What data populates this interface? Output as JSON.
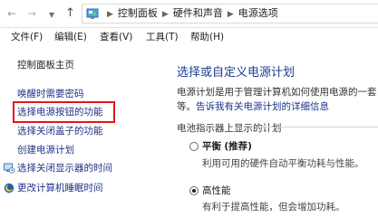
{
  "address": {
    "crumbs": [
      "控制面板",
      "硬件和声音",
      "电源选项"
    ]
  },
  "menu": [
    {
      "label": "文件(F)"
    },
    {
      "label": "编辑(E)"
    },
    {
      "label": "查看(V)"
    },
    {
      "label": "工具(T)"
    },
    {
      "label": "帮助(H)"
    }
  ],
  "sidebar": {
    "items": [
      {
        "label": "控制面板主页"
      },
      {
        "label": "唤醒时需要密码"
      },
      {
        "label": "选择电源按钮的功能"
      },
      {
        "label": "选择关闭盖子的功能"
      },
      {
        "label": "创建电源计划"
      },
      {
        "label": "选择关闭显示器的时间"
      },
      {
        "label": "更改计算机睡眠时间"
      }
    ]
  },
  "main": {
    "title": "选择或自定义电源计划",
    "desc_line1": "电源计划是用于管理计算机如何使用电源的一套",
    "desc_line2_prefix": "等。",
    "desc_line2_link": "告诉我有关电源计划的详细信息",
    "plans_header": "电池指示器上显示的计划",
    "plans": [
      {
        "name": "平衡",
        "tag": "(推荐)",
        "desc": "利用可用的硬件自动平衡功耗与性能。",
        "checked": false
      },
      {
        "name": "高性能",
        "tag": "",
        "desc": "有利于提高性能，但会增加功耗。",
        "checked": true
      }
    ]
  },
  "colors": {
    "link": "#1e3287",
    "title": "#1e3d8f",
    "highlight": "#e2141c"
  },
  "icons": {
    "back": "arrow-left-icon",
    "forward": "arrow-right-icon",
    "up": "arrow-up-icon",
    "control_panel": "control-panel-icon",
    "display": "monitor-clock-icon",
    "sleep": "moon-globe-icon"
  }
}
